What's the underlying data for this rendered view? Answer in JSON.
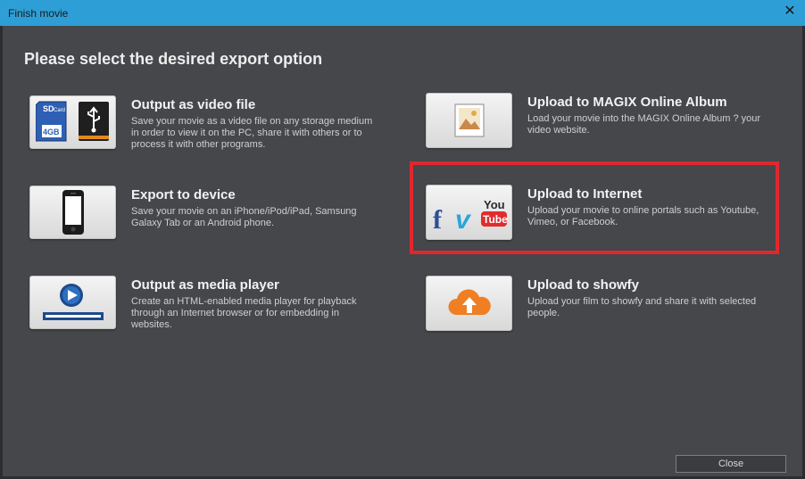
{
  "window": {
    "title": "Finish movie"
  },
  "heading": "Please select the desired export option",
  "options": [
    {
      "title": "Output as video file",
      "desc": "Save your movie as a video file on any storage medium in order to view it on the PC, share it with others or to process it with other programs.",
      "sd_top": "SD",
      "sd_card": "Card",
      "sd_size": "4GB"
    },
    {
      "title": "Export to device",
      "desc": "Save your movie on an iPhone/iPod/iPad, Samsung Galaxy Tab or an Android phone."
    },
    {
      "title": "Output as media player",
      "desc": "Create an HTML-enabled media player for playback through an Internet browser or for embedding in websites."
    },
    {
      "title": "Upload to MAGIX Online Album",
      "desc": "Load your movie into the MAGIX Online Album ? your video website."
    },
    {
      "title": "Upload to Internet",
      "desc": "Upload your movie to online portals such as Youtube, Vimeo, or Facebook.",
      "fb": "f",
      "vimeo": "v",
      "yt_you": "You",
      "yt_tube": "Tube"
    },
    {
      "title": "Upload to showfy",
      "desc": "Upload your film to showfy and share it with selected people."
    }
  ],
  "footer": {
    "close_label": "Close"
  },
  "colors": {
    "titlebar": "#2e9fd6",
    "panel": "#45474b",
    "highlight": "#e0272e",
    "showfy_orange": "#f07f23"
  }
}
